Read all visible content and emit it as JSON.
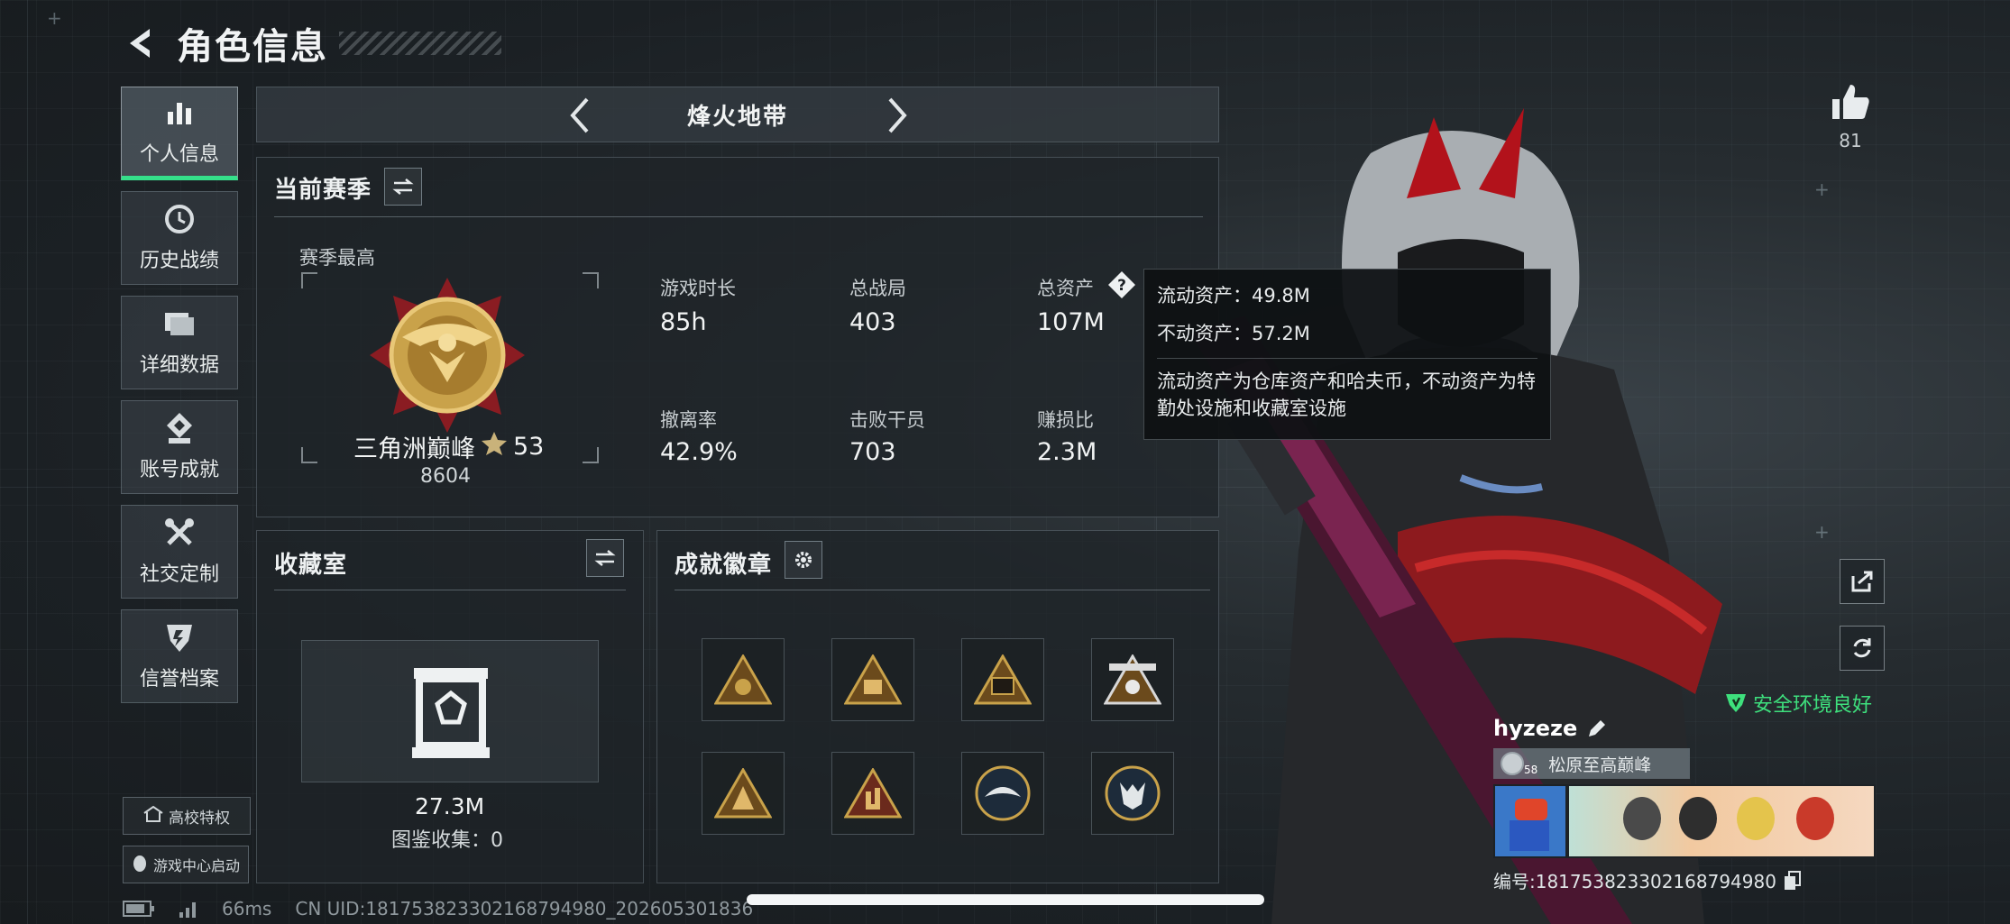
{
  "header": {
    "title": "角色信息"
  },
  "sidebar": {
    "items": [
      {
        "label": "个人信息",
        "icon": "bar-chart-icon",
        "active": true
      },
      {
        "label": "历史战绩",
        "icon": "history-icon"
      },
      {
        "label": "详细数据",
        "icon": "folder-icon"
      },
      {
        "label": "账号成就",
        "icon": "achievement-icon"
      },
      {
        "label": "社交定制",
        "icon": "tools-icon"
      },
      {
        "label": "信誉档案",
        "icon": "shield-icon"
      }
    ],
    "campus_label": "高校特权",
    "gamecenter_label": "游戏中心启动"
  },
  "mode_nav": {
    "title": "烽火地带"
  },
  "season": {
    "title": "当前赛季",
    "best_label": "赛季最高",
    "rank_name": "三角洲巅峰",
    "rank_stars": "53",
    "rank_score": "8604",
    "stats": [
      {
        "label": "游戏时长",
        "value": "85h"
      },
      {
        "label": "总战局",
        "value": "403"
      },
      {
        "label": "总资产",
        "value": "107M"
      },
      {
        "label": "撤离率",
        "value": "42.9%"
      },
      {
        "label": "击败干员",
        "value": "703"
      },
      {
        "label": "赚损比",
        "value": "2.3M"
      }
    ]
  },
  "tooltip": {
    "liquid": "流动资产：49.8M",
    "fixed": "不动资产：57.2M",
    "desc": "流动资产为仓库资产和哈夫币，不动资产为特勤处设施和收藏室设施"
  },
  "collection": {
    "title": "收藏室",
    "value": "27.3M",
    "catalog": "图鉴收集：0"
  },
  "badges": {
    "title": "成就徽章"
  },
  "profile": {
    "likes": "81",
    "safe_env": "安全环境良好",
    "name": "hyzeze",
    "tag_level": "58",
    "tag_text": "松原至高巅峰",
    "player_id": "编号:18175382330216879498​0"
  },
  "status": {
    "ping": "66ms",
    "uid": "CN UID:18175382330216879498​0_202605301836"
  },
  "colors": {
    "accent_green": "#35e08a",
    "safe_green": "#3ee07d",
    "gold": "#c9a24a"
  }
}
